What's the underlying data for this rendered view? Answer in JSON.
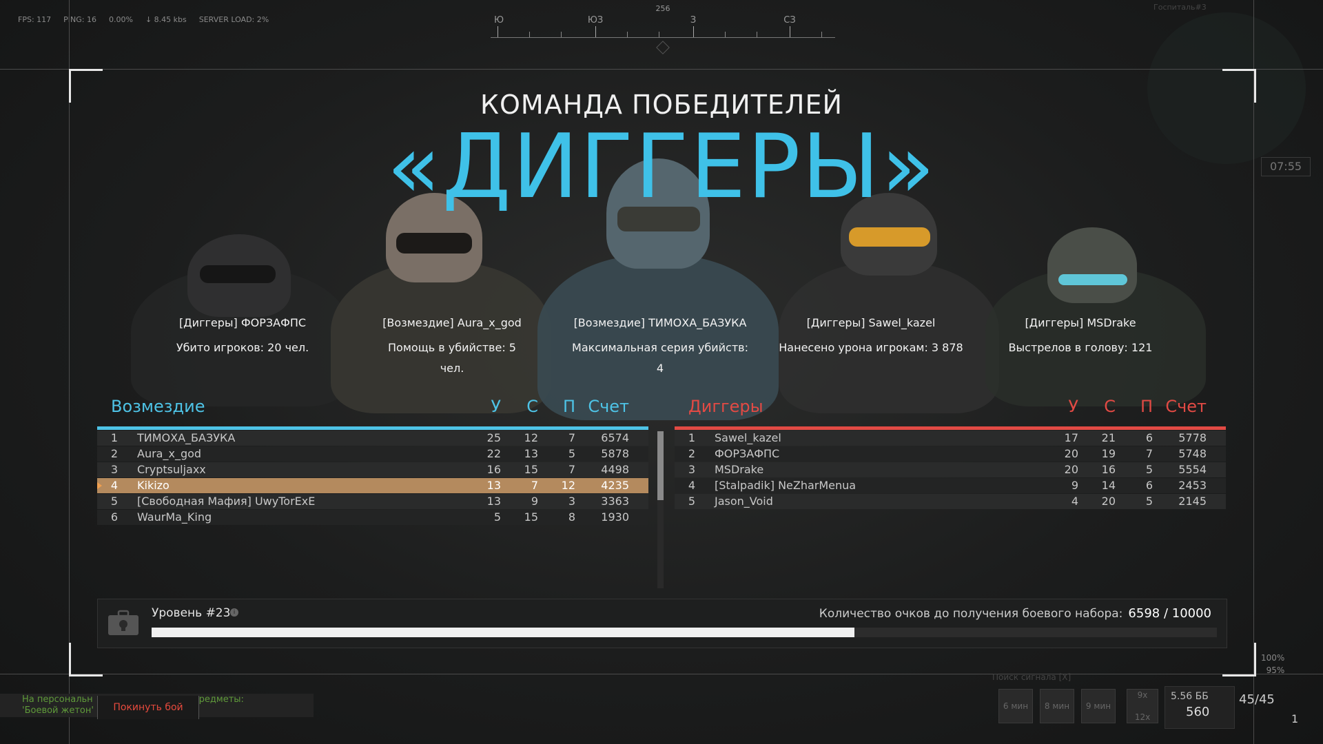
{
  "hud": {
    "fps": "FPS: 117",
    "ping": "PING: 16",
    "loss": "0.00%",
    "traffic": "↓ 8.45 kbs",
    "server_load": "SERVER LOAD: 2%"
  },
  "compass": {
    "bearing": "256",
    "labels": [
      "Ю",
      "ЮЗ",
      "З",
      "СЗ"
    ]
  },
  "minimap": {
    "title": "Госпиталь#3",
    "timer": "07:55"
  },
  "winner": {
    "subtitle": "КОМАНДА ПОБЕДИТЕЛЕЙ",
    "team": "«ДИГГЕРЫ»"
  },
  "awards": [
    {
      "player": "[Диггеры] ФОРЗАФПС",
      "stat": "Убито игроков: 20 чел."
    },
    {
      "player": "[Возмездие] Aura_x_god",
      "stat": "Помощь в убийстве: 5 чел."
    },
    {
      "player": "[Возмездие] ТИМОХА_БАЗУКА",
      "stat": "Максимальная серия убийств: 4"
    },
    {
      "player": "[Диггеры] Sawel_kazel",
      "stat": "Нанесено урона игрокам: 3 878"
    },
    {
      "player": "[Диггеры] MSDrake",
      "stat": "Выстрелов в голову: 121"
    }
  ],
  "columns": {
    "k": "У",
    "d": "С",
    "a": "П",
    "score": "Счет"
  },
  "team_left": {
    "name": "Возмездие",
    "color": "#4ec3e6",
    "rows": [
      {
        "rank": "1",
        "name": "ТИМОХА_БАЗУКА",
        "k": "25",
        "d": "12",
        "a": "7",
        "score": "6574"
      },
      {
        "rank": "2",
        "name": "Aura_x_god",
        "k": "22",
        "d": "13",
        "a": "5",
        "score": "5878"
      },
      {
        "rank": "3",
        "name": "Cryptsuljaxx",
        "k": "16",
        "d": "15",
        "a": "7",
        "score": "4498"
      },
      {
        "rank": "4",
        "name": "Kikizo",
        "k": "13",
        "d": "7",
        "a": "12",
        "score": "4235"
      },
      {
        "rank": "5",
        "name": "[Свободная Мафия] UwyTorExE",
        "k": "13",
        "d": "9",
        "a": "3",
        "score": "3363"
      },
      {
        "rank": "6",
        "name": "WaurMa_King",
        "k": "5",
        "d": "15",
        "a": "8",
        "score": "1930"
      }
    ]
  },
  "team_right": {
    "name": "Диггеры",
    "color": "#e24a44",
    "rows": [
      {
        "rank": "1",
        "name": "Sawel_kazel",
        "k": "17",
        "d": "21",
        "a": "6",
        "score": "5778"
      },
      {
        "rank": "2",
        "name": "ФОРЗАФПС",
        "k": "20",
        "d": "19",
        "a": "7",
        "score": "5748"
      },
      {
        "rank": "3",
        "name": "MSDrake",
        "k": "20",
        "d": "16",
        "a": "5",
        "score": "5554"
      },
      {
        "rank": "4",
        "name": "[Stalpadik] NeZharMenua",
        "k": "9",
        "d": "14",
        "a": "6",
        "score": "2453"
      },
      {
        "rank": "5",
        "name": "Jason_Void",
        "k": "4",
        "d": "20",
        "a": "5",
        "score": "2145"
      }
    ]
  },
  "level": {
    "title": "Уровень #23",
    "points_label": "Количество очков до получения боевого набора:",
    "points": "6598 / 10000",
    "progress": 0.6598
  },
  "bottom": {
    "chat_line1": "На персональн",
    "chat_line1b": "редметы:",
    "chat_line2": "'Боевой жетон' (",
    "leave": "Покинуть бой",
    "signal": "Поиск сигнала [X]",
    "slots": [
      "6 мин",
      "8 мин",
      "9 мин"
    ],
    "ammo_left": "5.56 ББ",
    "ammo_count": "560",
    "ammo_mag": "45/45",
    "grenades": "1",
    "scope": "9x",
    "scope2": "12x",
    "armor1": "100%",
    "armor2": "95%"
  }
}
